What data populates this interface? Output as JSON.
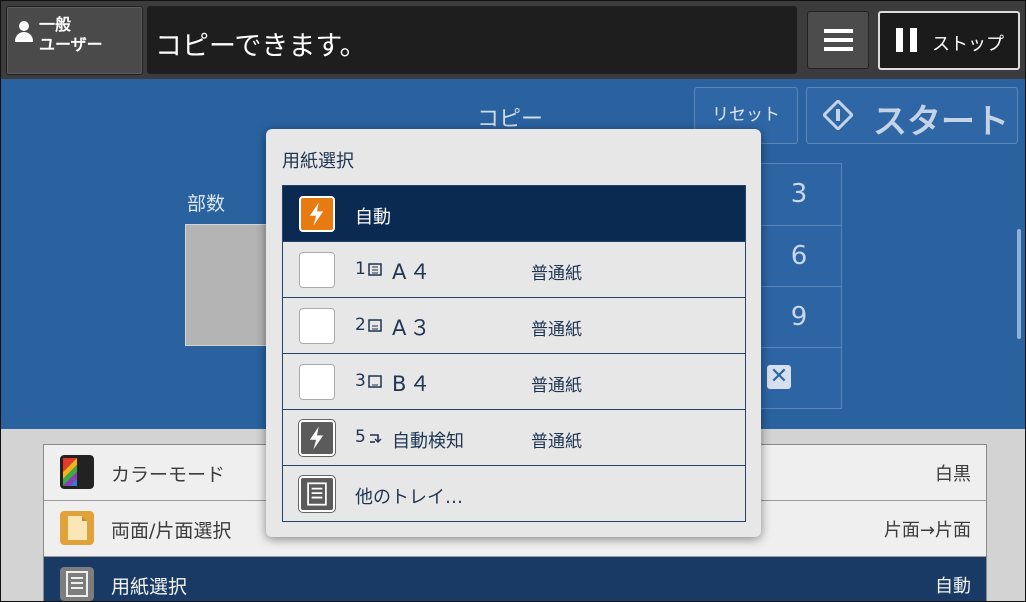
{
  "header": {
    "user_line1": "一般",
    "user_line2": "ユーザー",
    "message": "コピーできます。",
    "stop_label": "ストップ"
  },
  "copy": {
    "title": "コピー",
    "reset_label": "リセット",
    "start_label": "スタート",
    "copies_label": "部数",
    "keypad": [
      "3",
      "6",
      "9"
    ]
  },
  "settings_list": [
    {
      "label": "カラーモード",
      "value": "白黒",
      "icon": "color-mode-icon"
    },
    {
      "label": "両面/片面選択",
      "value": "片面→片面",
      "icon": "duplex-icon"
    },
    {
      "label": "用紙選択",
      "value": "自動",
      "icon": "paper-select-icon",
      "selected": true
    }
  ],
  "popup": {
    "title": "用紙選択",
    "options": [
      {
        "label": "自動",
        "icon": "auto-flash-icon",
        "selected": true
      },
      {
        "tray": "1",
        "size": "A４",
        "type": "普通紙",
        "icon": "paper-blank-icon"
      },
      {
        "tray": "2",
        "size": "A３",
        "type": "普通紙",
        "icon": "paper-blank-icon"
      },
      {
        "tray": "3",
        "size": "B４",
        "type": "普通紙",
        "icon": "paper-blank-icon"
      },
      {
        "tray": "5",
        "size": "自動検知",
        "type": "普通紙",
        "icon": "bypass-flash-icon"
      },
      {
        "label": "他のトレイ…",
        "icon": "tray-list-icon"
      }
    ]
  },
  "colors": {
    "copy_area": "#2a62a0",
    "selected_row": "#0b2a52",
    "auto_icon": "#e87a12"
  }
}
